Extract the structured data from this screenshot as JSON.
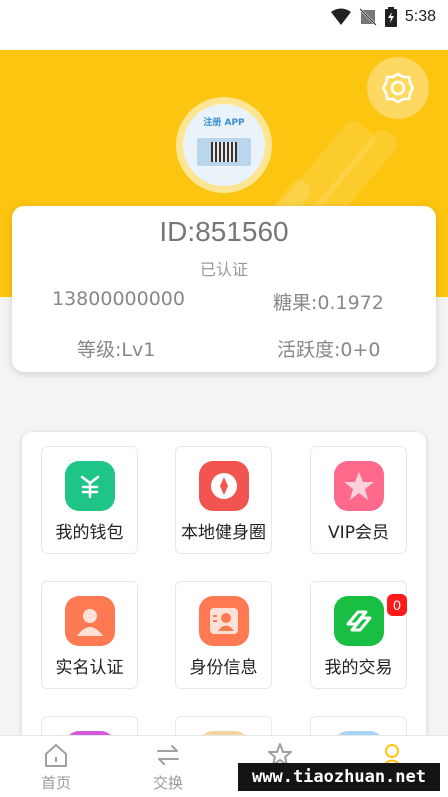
{
  "status_bar": {
    "time": "5:38"
  },
  "profile": {
    "id_text": "ID:851560",
    "verified": "已认证",
    "phone": "13800000000",
    "candy": "糖果:0.1972",
    "level": "等级:Lv1",
    "activity": "活跃度:0+0",
    "avatar_text": "注册 APP"
  },
  "menu": {
    "items": [
      {
        "label": "我的钱包",
        "icon": "wallet-icon",
        "color": "#1fc587"
      },
      {
        "label": "本地健身圈",
        "icon": "fitness-circle-icon",
        "color": "#f2544f"
      },
      {
        "label": "VIP会员",
        "icon": "vip-star-icon",
        "color": "#ff6a8c"
      },
      {
        "label": "实名认证",
        "icon": "real-name-icon",
        "color": "#ff7a52"
      },
      {
        "label": "身份信息",
        "icon": "id-card-icon",
        "color": "#ff7a52"
      },
      {
        "label": "我的交易",
        "icon": "trade-link-icon",
        "color": "#18bf43",
        "badge": "0"
      }
    ]
  },
  "bottom_nav": {
    "items": [
      {
        "label": "首页",
        "icon": "home-icon"
      },
      {
        "label": "交换",
        "icon": "exchange-icon"
      },
      {
        "label": "",
        "icon": "star-icon"
      },
      {
        "label": "",
        "icon": "user-icon",
        "active_color": "#fcc510"
      }
    ]
  },
  "watermark": "www.tiaozhuan.net",
  "colors": {
    "brand_yellow": "#fcc510",
    "badge_red": "#ff1a1a"
  }
}
